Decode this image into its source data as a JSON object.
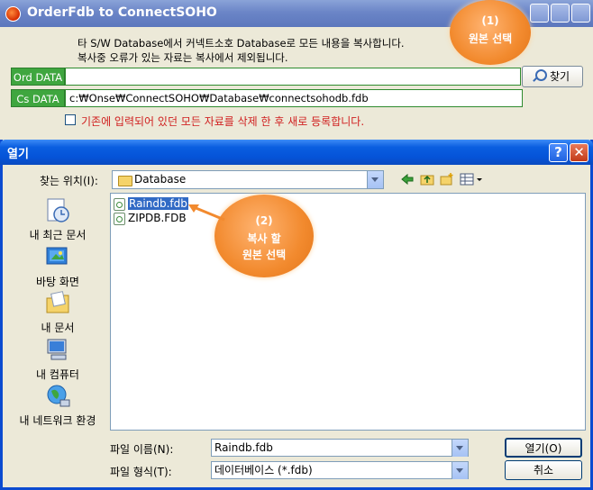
{
  "back_window": {
    "title": "OrderFdb to ConnectSOHO",
    "message_line1": "타 S/W Database에서 커넥트소호 Database로 모든 내용을 복사합니다.",
    "message_line2": "복사중 오류가 있는 자료는 복사에서 제외됩니다.",
    "ord_label": "Ord DATA",
    "ord_value": "",
    "cs_label": "Cs DATA",
    "cs_value": "c:₩Onse₩ConnectSOHO₩Database₩connectsohodb.fdb",
    "find_button": "찾기",
    "checkbox_label": "기존에 입력되어 있던 모든 자료를 삭제 한 후 새로 등록합니다.",
    "checkbox_checked": false
  },
  "callout1": {
    "line1": "(1)",
    "line2": "원본 선택"
  },
  "callout2": {
    "line1": "(2)",
    "line2": "복사 할",
    "line3": "원본 선택"
  },
  "dialog": {
    "title": "열기",
    "help_label": "?",
    "close_label": "✕",
    "look_in_label": "찾는 위치(I):",
    "look_in_value": "Database",
    "places": [
      {
        "label": "내 최근 문서",
        "icon": "recent-documents-icon"
      },
      {
        "label": "바탕 화면",
        "icon": "desktop-icon"
      },
      {
        "label": "내 문서",
        "icon": "my-documents-icon"
      },
      {
        "label": "내 컴퓨터",
        "icon": "my-computer-icon"
      },
      {
        "label": "내 네트워크 환경",
        "icon": "network-places-icon"
      }
    ],
    "files": [
      {
        "name": "Raindb.fdb",
        "selected": true
      },
      {
        "name": "ZIPDB.FDB",
        "selected": false
      }
    ],
    "filename_label": "파일 이름(N):",
    "filename_value": "Raindb.fdb",
    "filetype_label": "파일 형식(T):",
    "filetype_value": "데이터베이스 (*.fdb)",
    "open_button": "열기(O)",
    "cancel_button": "취소"
  },
  "colors": {
    "dialog_title": "#0a5ee0",
    "back_title": "#6b85c7",
    "data_label_bg": "#3fa63f",
    "callout": "#f28a2e",
    "selection": "#316ac5",
    "warning_text": "#d02020"
  }
}
